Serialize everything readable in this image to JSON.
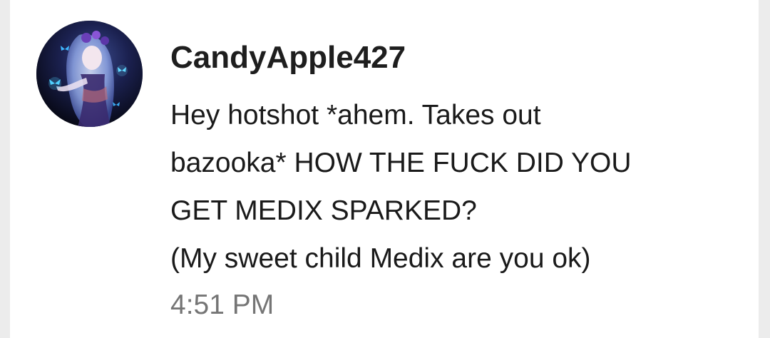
{
  "comment": {
    "username": "CandyApple427",
    "message_lines": [
      "Hey hotshot *ahem. Takes out",
      "bazooka* HOW THE FUCK DID YOU",
      "GET MEDIX SPARKED?",
      "(My sweet child Medix are you ok)"
    ],
    "timestamp": "4:51 PM",
    "avatar_icon": "anime-character-avatar"
  },
  "colors": {
    "background": "#ececec",
    "card": "#ffffff",
    "username": "#1e1e1e",
    "text": "#1a1a1a",
    "timestamp": "#757575"
  }
}
